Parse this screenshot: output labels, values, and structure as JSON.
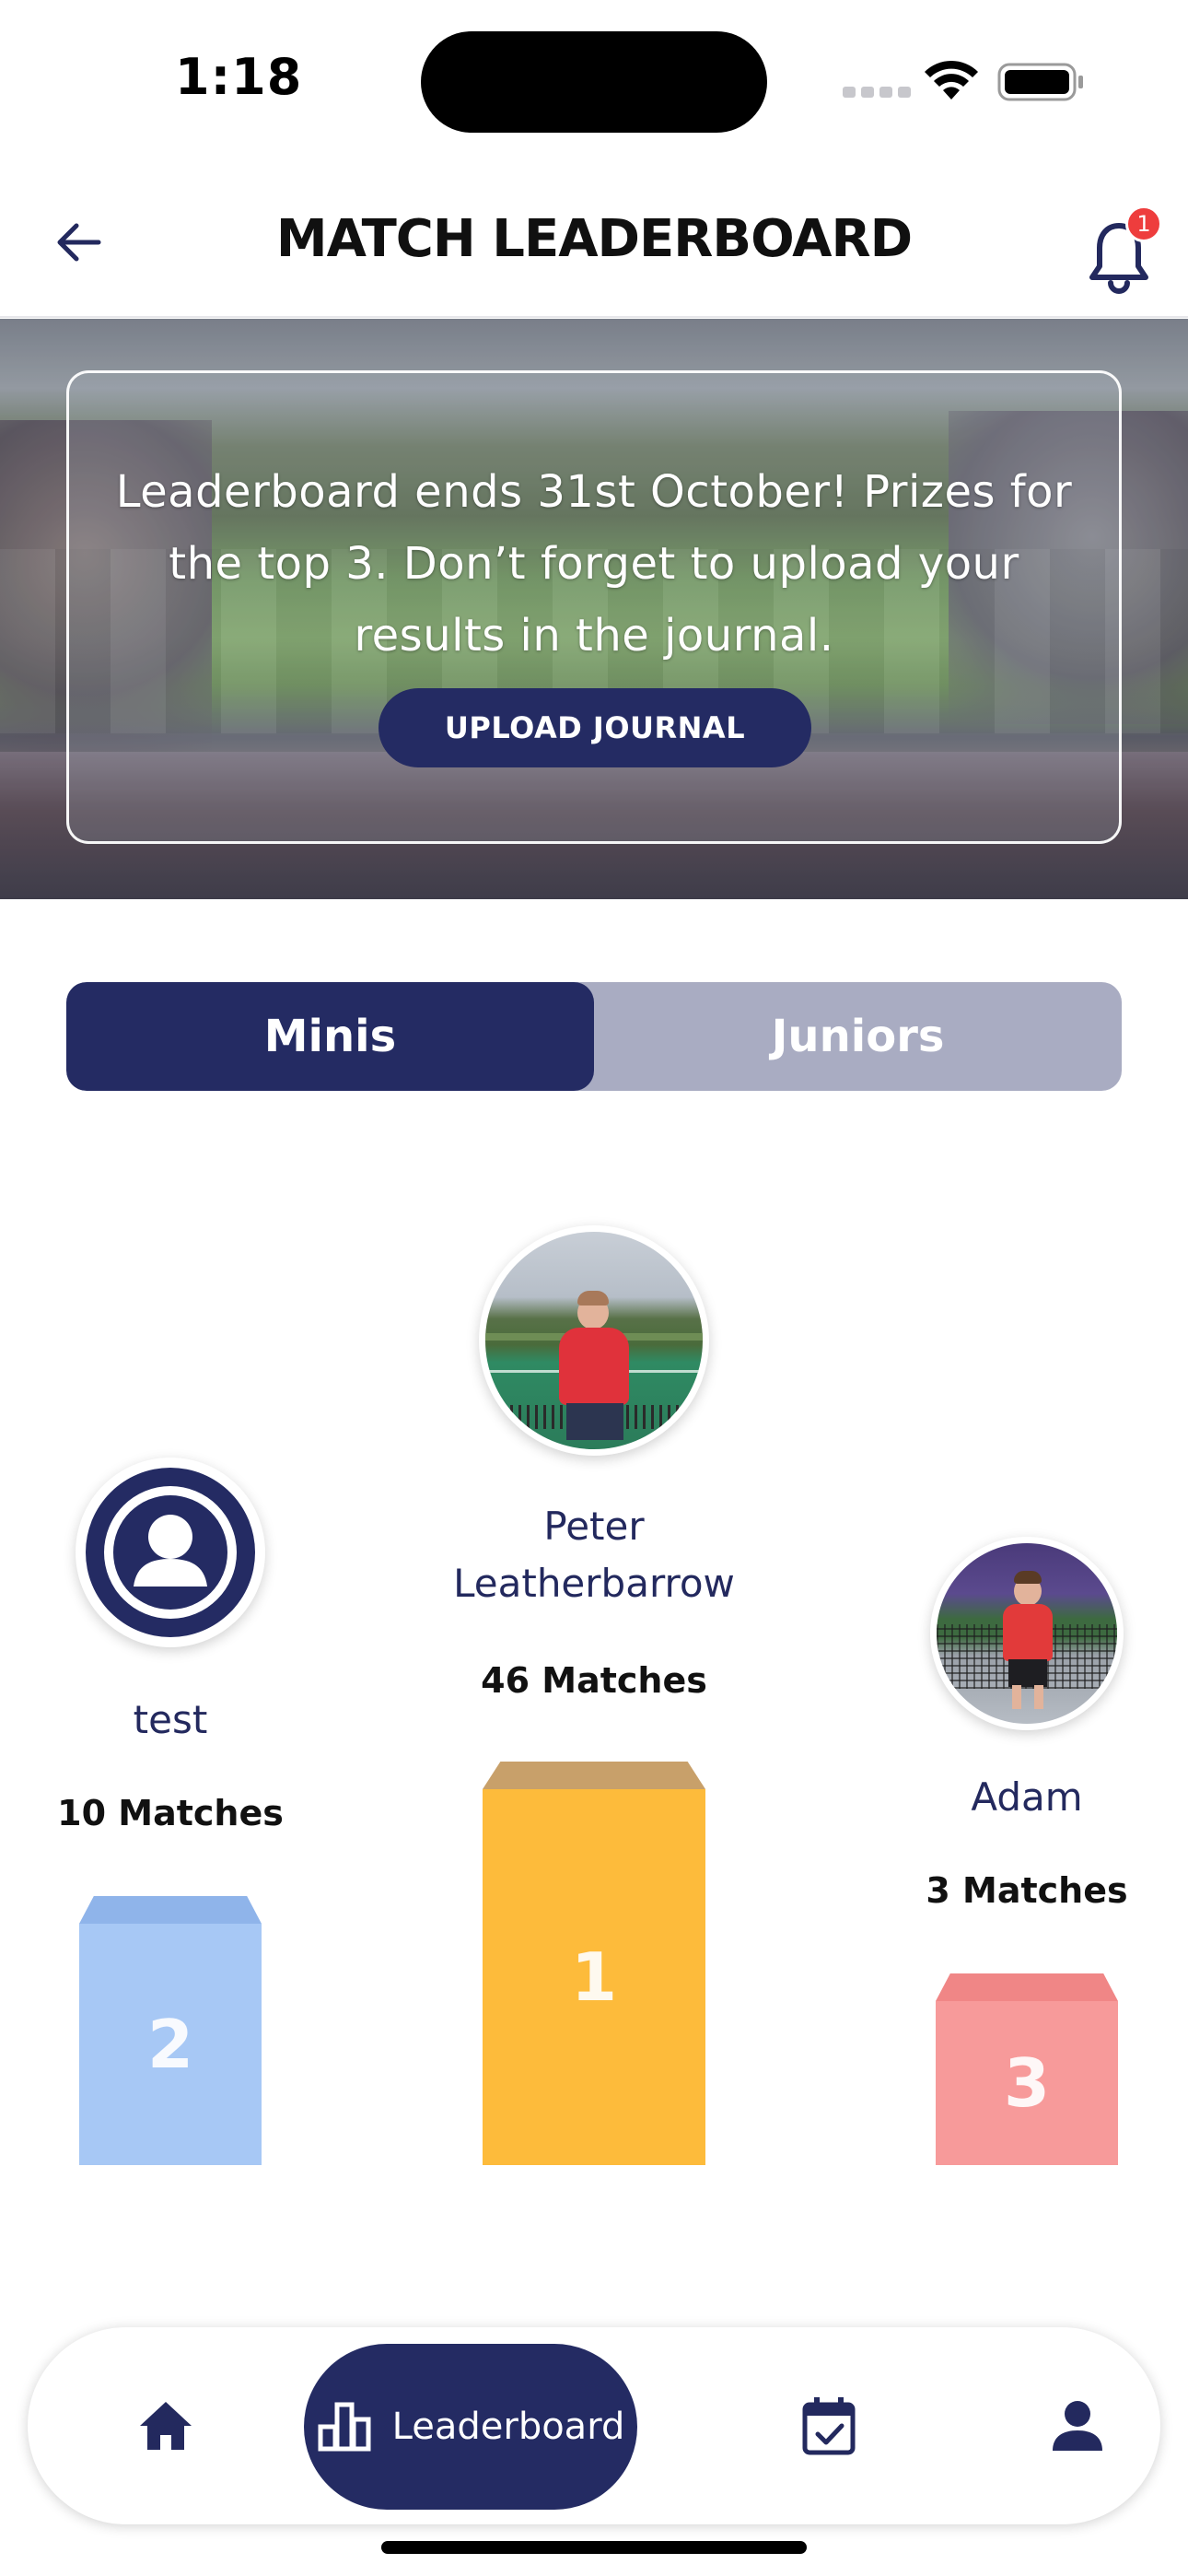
{
  "status_bar": {
    "time": "1:18"
  },
  "header": {
    "title": "MATCH LEADERBOARD",
    "notification_count": "1"
  },
  "banner": {
    "message": "Leaderboard ends 31st October! Prizes for the top 3. Don’t forget to upload your results in the journal.",
    "button_label": "UPLOAD JOURNAL"
  },
  "segment": {
    "tabs": [
      {
        "label": "Minis",
        "active": true
      },
      {
        "label": "Juniors",
        "active": false
      }
    ]
  },
  "podium": {
    "first": {
      "rank": "1",
      "name": "Peter Leatherbarrow",
      "matches": "46 Matches"
    },
    "second": {
      "rank": "2",
      "name": "test",
      "matches": "10 Matches"
    },
    "third": {
      "rank": "3",
      "name": "Adam",
      "matches": "3 Matches"
    }
  },
  "nav": {
    "active_label": "Leaderboard",
    "items": [
      "home-icon",
      "leaderboard-icon",
      "calendar-check-icon",
      "profile-icon"
    ]
  },
  "colors": {
    "navy": "#242b63",
    "gold": "#fdbb3b",
    "blue": "#a7c8f5",
    "red": "#f79a9a",
    "badge": "#ee3d3d"
  }
}
